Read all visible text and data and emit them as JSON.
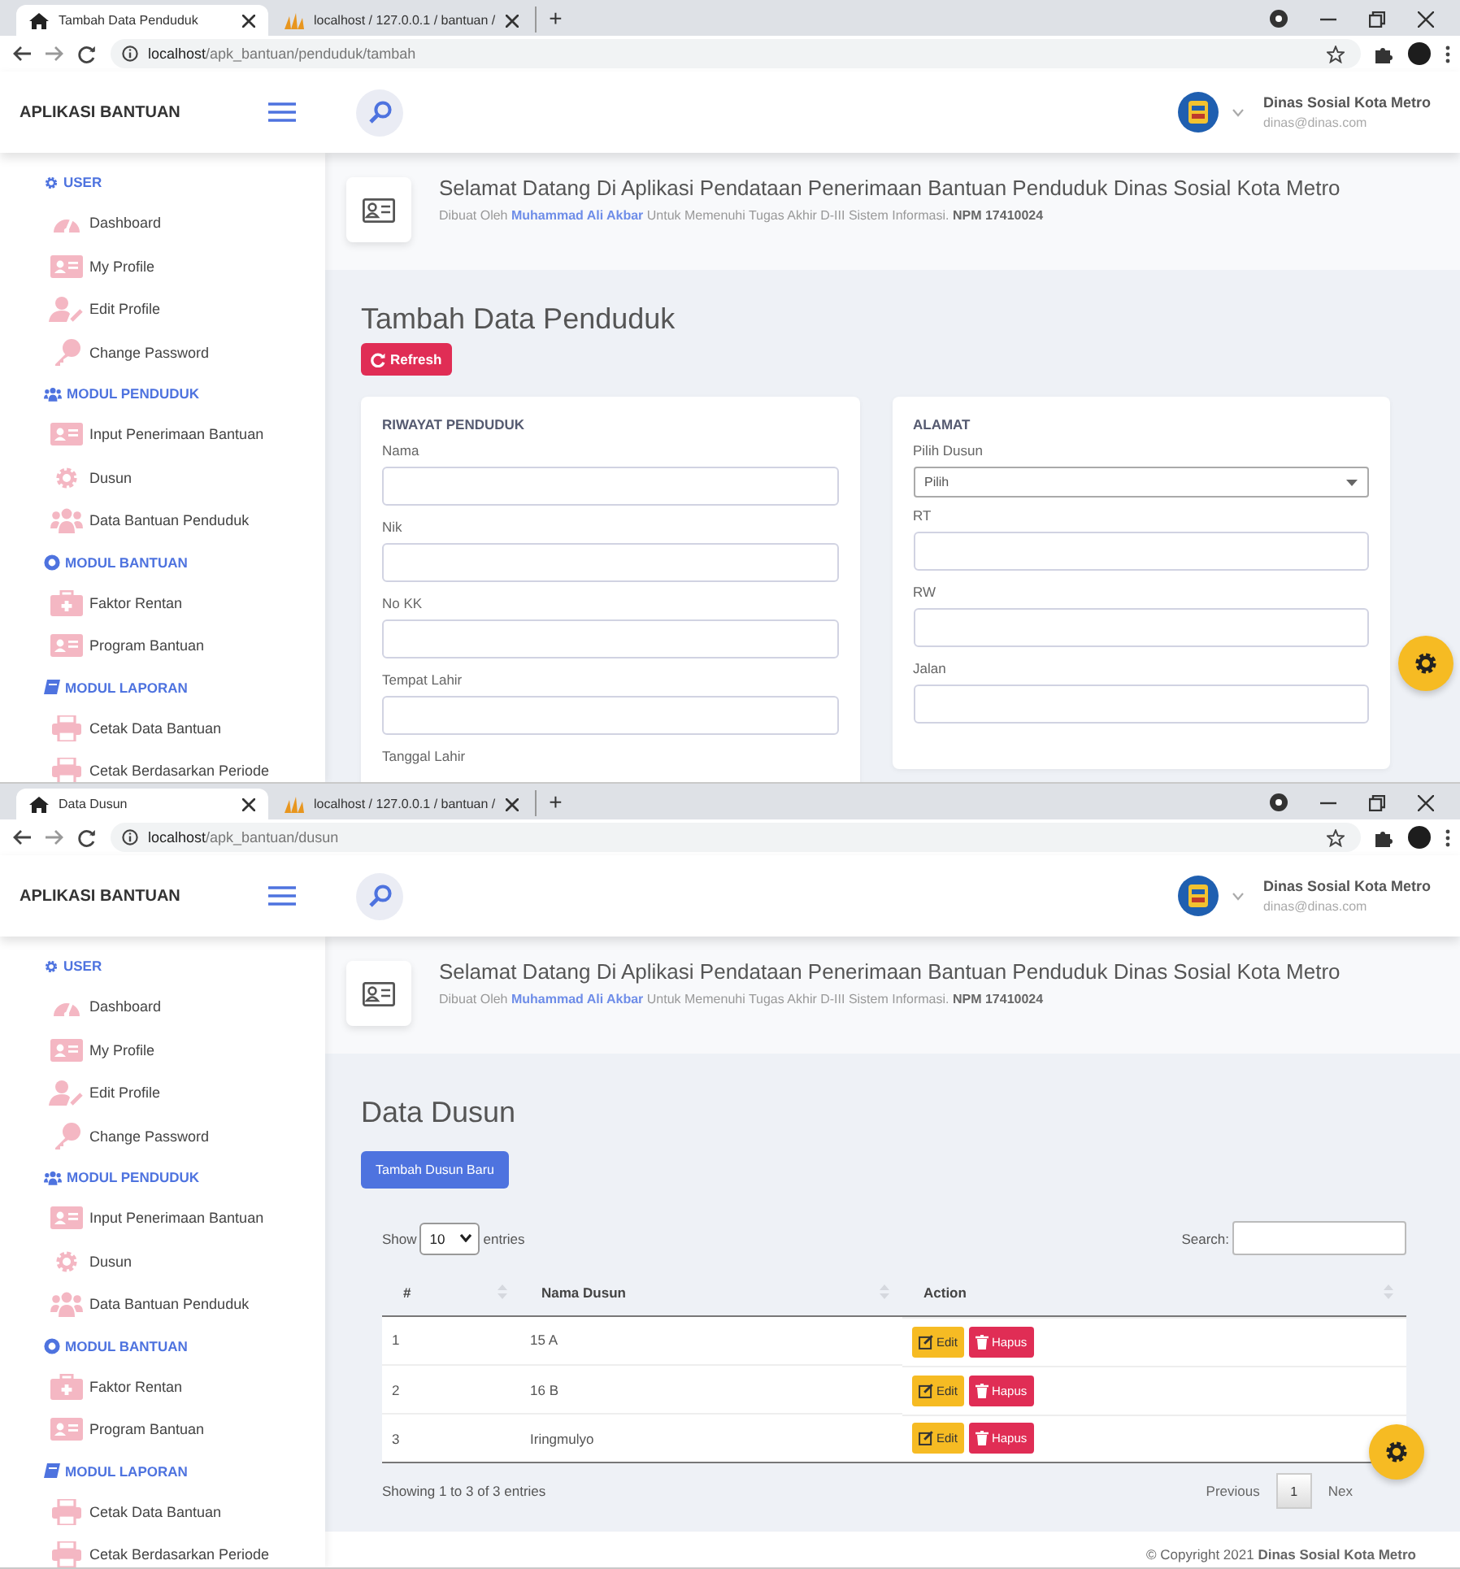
{
  "windows": [
    {
      "tabs": [
        {
          "title": "Tambah Data Penduduk",
          "selected": true,
          "kind": "home"
        },
        {
          "title": "localhost / 127.0.0.1 / bantuan /",
          "selected": false,
          "kind": "sails"
        }
      ],
      "new_tab": "+",
      "url": {
        "host": "localhost",
        "path": "/apk_bantuan/penduduk/tambah"
      },
      "header": {
        "brand": "APLIKASI BANTUAN",
        "user_name": "Dinas Sosial Kota Metro",
        "user_email": "dinas@dinas.com"
      },
      "sidebar": [
        {
          "heading": "USER",
          "kind": "gear",
          "items": [
            {
              "label": "Dashboard",
              "kind": "gauge"
            },
            {
              "label": "My Profile",
              "kind": "card"
            },
            {
              "label": "Edit Profile",
              "kind": "user"
            },
            {
              "label": "Change Password",
              "kind": "key"
            }
          ]
        },
        {
          "heading": "MODUL PENDUDUK",
          "kind": "group",
          "items": [
            {
              "label": "Input Penerimaan Bantuan",
              "kind": "card"
            },
            {
              "label": "Dusun",
              "kind": "gear"
            },
            {
              "label": "Data Bantuan Penduduk",
              "kind": "group"
            }
          ]
        },
        {
          "heading": "MODUL BANTUAN",
          "kind": "circle",
          "items": [
            {
              "label": "Faktor Rentan",
              "kind": "kit"
            },
            {
              "label": "Program Bantuan",
              "kind": "card"
            }
          ]
        },
        {
          "heading": "MODUL LAPORAN",
          "kind": "book",
          "items": [
            {
              "label": "Cetak Data Bantuan",
              "kind": "printer"
            },
            {
              "label": "Cetak Berdasarkan Periode",
              "kind": "printer"
            }
          ]
        }
      ],
      "banner": {
        "title": "Selamat Datang Di Aplikasi Pendataan Penerimaan Bantuan Penduduk Dinas Sosial Kota Metro",
        "credit_before": "Dibuat Oleh",
        "author": "Muhammad Ali Akbar",
        "credit_after": "Untuk Memenuhi Tugas Akhir D-III Sistem Informasi. **NPM 17410024**"
      },
      "page": {
        "kind": "form",
        "title": "Tambah Data Penduduk",
        "refresh_button": "Refresh",
        "cards": [
          {
            "title": "RIWAYAT PENDUDUK",
            "fields": [
              {
                "label": "Nama",
                "kind": "text"
              },
              {
                "label": "Nik",
                "kind": "text"
              },
              {
                "label": "No KK",
                "kind": "text"
              },
              {
                "label": "Tempat Lahir",
                "kind": "text"
              },
              {
                "label": "Tanggal Lahir"
              }
            ]
          },
          {
            "title": "ALAMAT",
            "fields": [
              {
                "label": "Pilih Dusun",
                "kind": "select",
                "value": "Pilih"
              },
              {
                "label": "RT",
                "kind": "text"
              },
              {
                "label": "RW",
                "kind": "text"
              },
              {
                "label": "Jalan",
                "kind": "text"
              }
            ]
          }
        ]
      }
    },
    {
      "tabs": [
        {
          "title": "Data Dusun",
          "selected": true,
          "kind": "home"
        },
        {
          "title": "localhost / 127.0.0.1 / bantuan /",
          "selected": false,
          "kind": "sails"
        }
      ],
      "new_tab": "+",
      "url": {
        "host": "localhost",
        "path": "/apk_bantuan/dusun"
      },
      "header": {
        "brand": "APLIKASI BANTUAN",
        "user_name": "Dinas Sosial Kota Metro",
        "user_email": "dinas@dinas.com"
      },
      "sidebar": [
        {
          "heading": "USER",
          "kind": "gear",
          "items": [
            {
              "label": "Dashboard",
              "kind": "gauge"
            },
            {
              "label": "My Profile",
              "kind": "card"
            },
            {
              "label": "Edit Profile",
              "kind": "user"
            },
            {
              "label": "Change Password",
              "kind": "key"
            }
          ]
        },
        {
          "heading": "MODUL PENDUDUK",
          "kind": "group",
          "items": [
            {
              "label": "Input Penerimaan Bantuan",
              "kind": "card"
            },
            {
              "label": "Dusun",
              "kind": "gear"
            },
            {
              "label": "Data Bantuan Penduduk",
              "kind": "group"
            }
          ]
        },
        {
          "heading": "MODUL BANTUAN",
          "kind": "circle",
          "items": [
            {
              "label": "Faktor Rentan",
              "kind": "kit"
            },
            {
              "label": "Program Bantuan",
              "kind": "card"
            }
          ]
        },
        {
          "heading": "MODUL LAPORAN",
          "kind": "book",
          "items": [
            {
              "label": "Cetak Data Bantuan",
              "kind": "printer"
            },
            {
              "label": "Cetak Berdasarkan Periode",
              "kind": "printer"
            }
          ]
        }
      ],
      "banner": {
        "title": "Selamat Datang Di Aplikasi Pendataan Penerimaan Bantuan Penduduk Dinas Sosial Kota Metro",
        "credit_before": "Dibuat Oleh",
        "author": "Muhammad Ali Akbar",
        "credit_after": "Untuk Memenuhi Tugas Akhir D-III Sistem Informasi. **NPM 17410024**"
      },
      "page": {
        "kind": "table",
        "title": "Data Dusun",
        "add_button": "Tambah Dusun Baru",
        "length": {
          "before": "Show",
          "value": "10",
          "after": "entries"
        },
        "search_label": "Search:",
        "columns": [
          "#",
          "Nama Dusun",
          "Action"
        ],
        "rows": [
          {
            "cells": [
              "1",
              "15 A"
            ],
            "actions": [
              {
                "label": "Edit",
                "kind": "edit"
              },
              {
                "label": "Hapus",
                "kind": "delete"
              }
            ]
          },
          {
            "cells": [
              "2",
              "16 B"
            ],
            "actions": [
              {
                "label": "Edit",
                "kind": "edit"
              },
              {
                "label": "Hapus",
                "kind": "delete"
              }
            ]
          },
          {
            "cells": [
              "3",
              "Iringmulyo"
            ],
            "actions": [
              {
                "label": "Edit",
                "kind": "edit"
              },
              {
                "label": "Hapus",
                "kind": "delete"
              }
            ]
          }
        ],
        "info": "Showing 1 to 3 of 3 entries",
        "pagination": {
          "previous": "Previous",
          "pages": [
            {
              "label": "1",
              "selected": true
            }
          ],
          "next": "Nex"
        }
      },
      "footer": "© Copyright 2021 **Dinas Sosial Kota Metro**"
    }
  ]
}
